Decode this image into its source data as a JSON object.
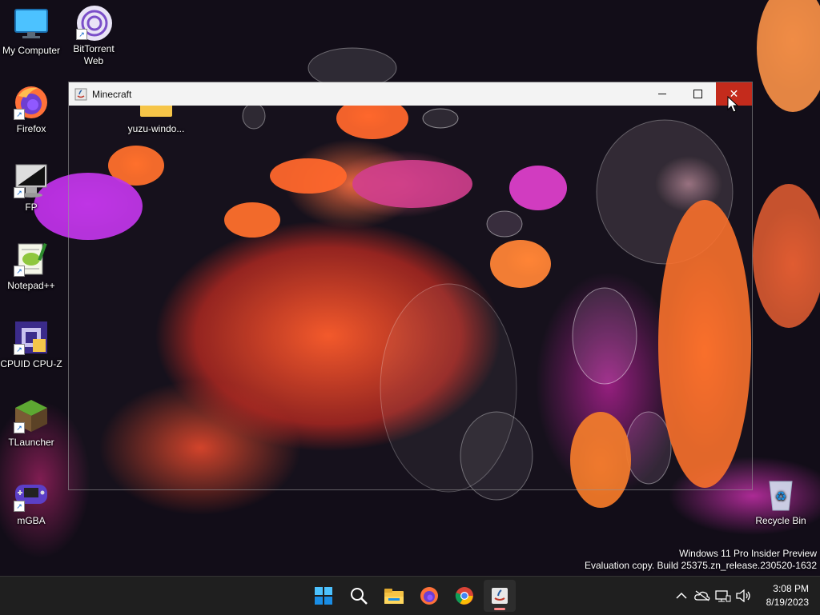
{
  "desktop": {
    "icons": [
      {
        "label": "My Computer",
        "icon": "monitor-icon"
      },
      {
        "label": "BitTorrent Web",
        "icon": "bittorrent-icon"
      },
      {
        "label": "Firefox",
        "icon": "firefox-icon"
      },
      {
        "label": "FP",
        "icon": "fp-icon"
      },
      {
        "label": "Notepad++",
        "icon": "notepadpp-icon"
      },
      {
        "label": "CPUID CPU-Z",
        "icon": "cpuz-icon"
      },
      {
        "label": "TLauncher",
        "icon": "tlauncher-icon"
      },
      {
        "label": "mGBA",
        "icon": "mgba-icon"
      },
      {
        "label": "yuzu-windo...",
        "icon": "folder-icon"
      },
      {
        "label": "Recycle Bin",
        "icon": "recycle-bin-icon"
      }
    ]
  },
  "window": {
    "title": "Minecraft",
    "minimize_label": "—",
    "maximize_label": "☐",
    "close_label": "✕"
  },
  "watermark": {
    "line1": "Windows 11 Pro Insider Preview",
    "line2": "Evaluation copy. Build 25375.zn_release.230520-1632"
  },
  "taskbar": {
    "items": [
      "start-icon",
      "search-icon",
      "file-explorer-icon",
      "firefox-icon",
      "chrome-icon",
      "java-icon"
    ],
    "time": "3:08 PM",
    "date": "8/19/2023"
  },
  "colors": {
    "close_button": "#c42b1c",
    "taskbar": "#1f1f1f",
    "titlebar": "#f3f3f3"
  }
}
